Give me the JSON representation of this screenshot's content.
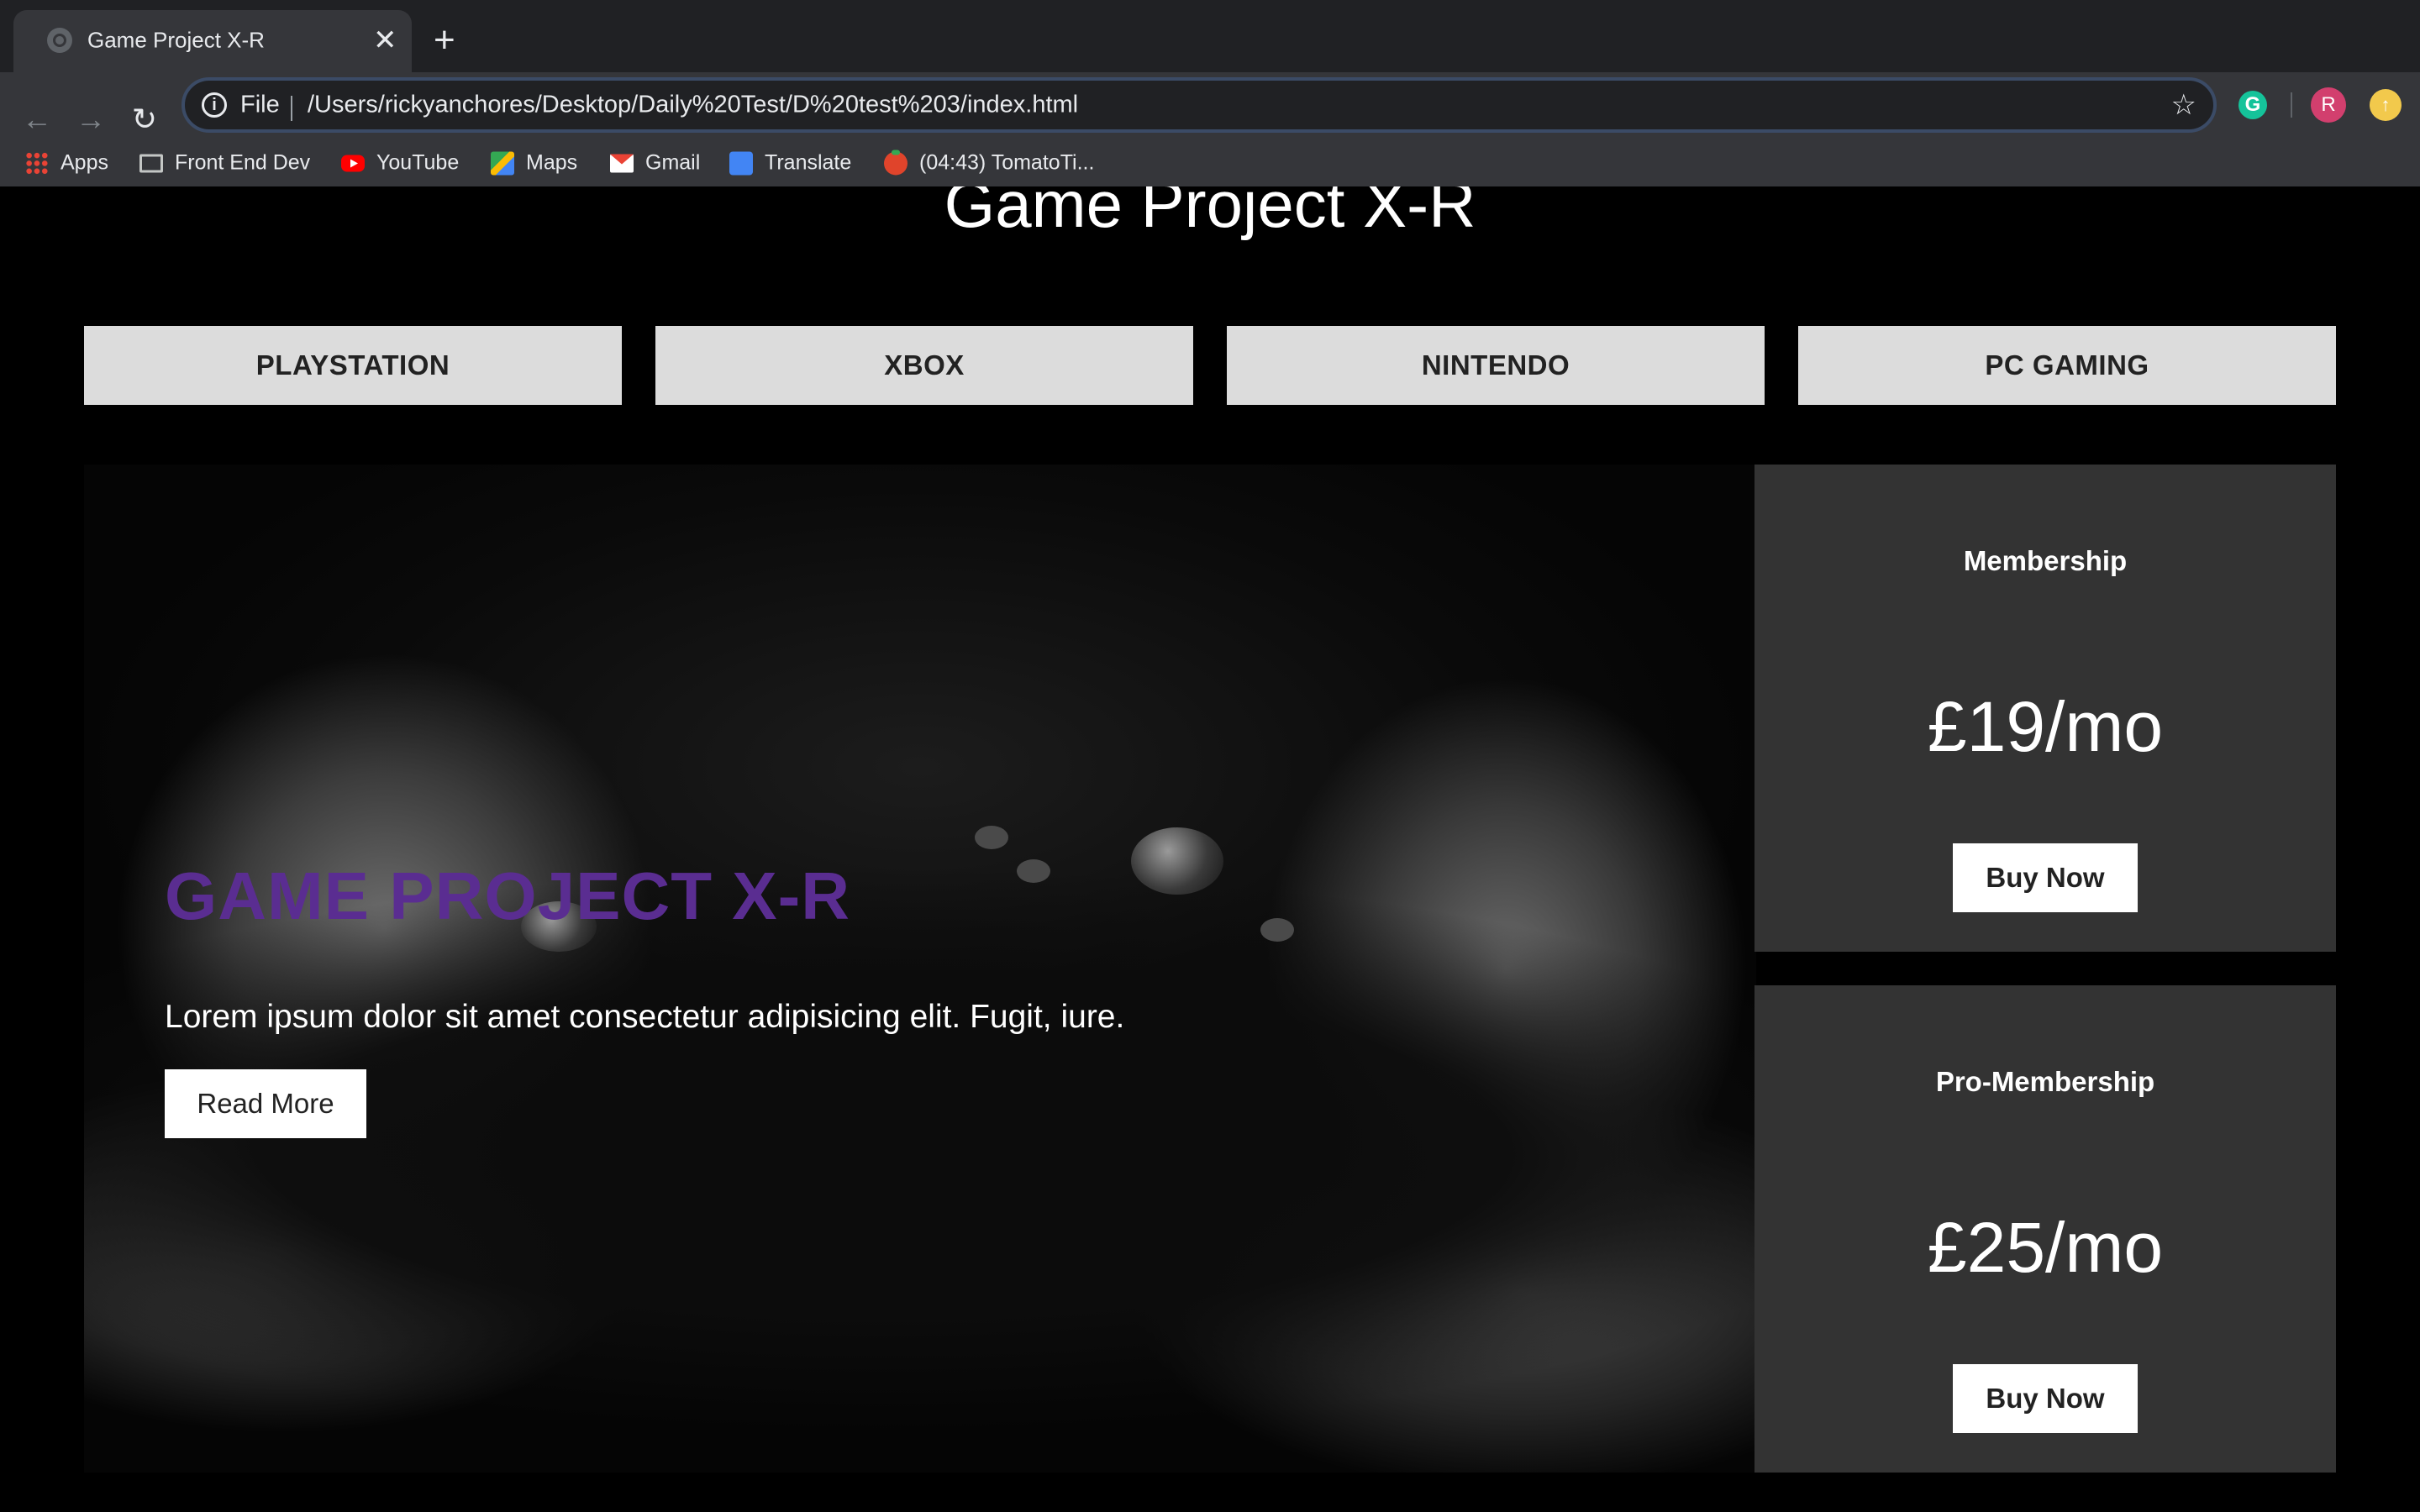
{
  "browser": {
    "tab_title": "Game Project X-R",
    "tab_close": "✕",
    "new_tab": "+",
    "url_scheme": "File",
    "url": "/Users/rickyanchores/Desktop/Daily%20Test/D%20test%203/index.html",
    "profile_initial": "R",
    "grammarly_letter": "G",
    "bookmarks": [
      {
        "label": "Apps",
        "icon": "apps-grid-icon"
      },
      {
        "label": "Front End Dev",
        "icon": "folder-icon"
      },
      {
        "label": "YouTube",
        "icon": "youtube-icon"
      },
      {
        "label": "Maps",
        "icon": "maps-icon"
      },
      {
        "label": "Gmail",
        "icon": "gmail-icon"
      },
      {
        "label": "Translate",
        "icon": "translate-icon"
      },
      {
        "label": "(04:43) TomatoTi...",
        "icon": "tomato-timer-icon"
      }
    ]
  },
  "page": {
    "site_title": "Game Project X-R",
    "platforms": [
      "PLAYSTATION",
      "XBOX",
      "NINTENDO",
      "PC GAMING"
    ],
    "hero": {
      "title": "GAME PROJECT X-R",
      "text": "Lorem ipsum dolor sit amet consectetur adipisicing elit. Fugit, iure.",
      "button": "Read More"
    },
    "plans": [
      {
        "name": "Membership",
        "price": "£19/mo",
        "button": "Buy Now"
      },
      {
        "name": "Pro-Membership",
        "price": "£25/mo",
        "button": "Buy Now"
      }
    ]
  },
  "colors": {
    "hero_title": "#5a2d91",
    "platform_bg": "#dcdcdc",
    "card_bg": "#333333",
    "page_bg": "#000000"
  }
}
